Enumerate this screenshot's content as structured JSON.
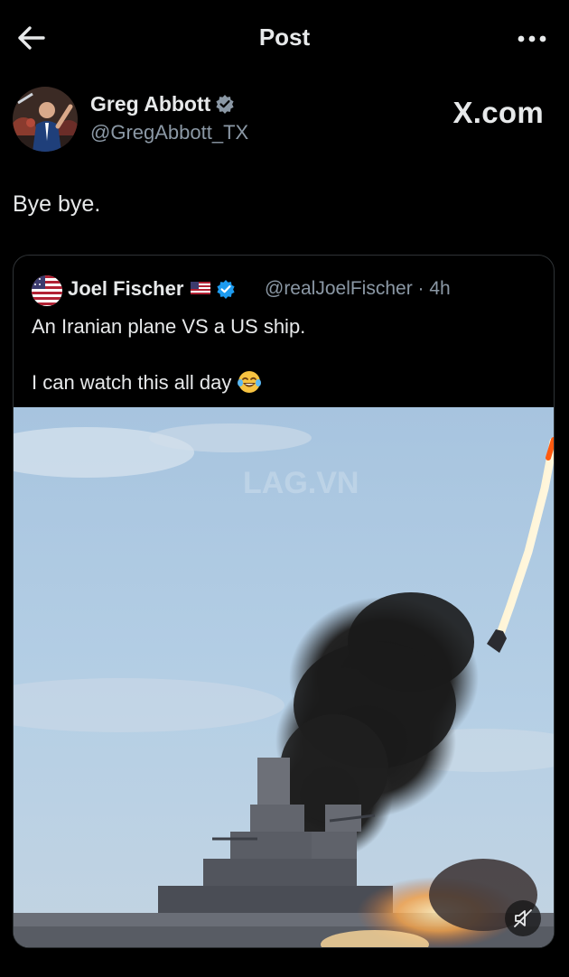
{
  "header": {
    "title": "Post",
    "back_icon": "arrow-left-icon",
    "more_icon": "more-horizontal-icon"
  },
  "author": {
    "name": "Greg Abbott",
    "handle": "@GregAbbott_TX",
    "verified": true
  },
  "watermark": "X.com",
  "tweet": {
    "text": "Bye bye."
  },
  "quote": {
    "name": "Joel Fischer",
    "handle": "@realJoelFischer · 4h",
    "line1": "An Iranian plane VS a US ship.",
    "line2": "I can watch this all day",
    "emoji": "tears-of-joy-emoji"
  },
  "media": {
    "type": "video",
    "overlay_watermark": "LAG.VN",
    "mute_icon": "mute-icon"
  },
  "colors": {
    "background": "#000000",
    "text": "#e7e9ea",
    "secondary": "#8b98a5",
    "verified": "#1d9bf0",
    "border": "#2f3336"
  }
}
